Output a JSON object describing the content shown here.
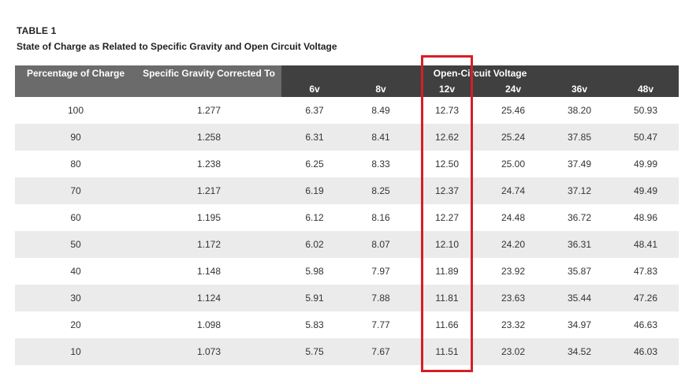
{
  "title": "TABLE 1",
  "caption": "State of Charge as Related to Specific Gravity and Open Circuit Voltage",
  "headers": {
    "percentage": "Percentage of Charge",
    "gravity": "Specific Gravity Corrected To",
    "voltage_group": "Open-Circuit Voltage",
    "voltages": [
      "6v",
      "8v",
      "12v",
      "24v",
      "36v",
      "48v"
    ]
  },
  "rows": [
    [
      "100",
      "1.277",
      "6.37",
      "8.49",
      "12.73",
      "25.46",
      "38.20",
      "50.93"
    ],
    [
      "90",
      "1.258",
      "6.31",
      "8.41",
      "12.62",
      "25.24",
      "37.85",
      "50.47"
    ],
    [
      "80",
      "1.238",
      "6.25",
      "8.33",
      "12.50",
      "25.00",
      "37.49",
      "49.99"
    ],
    [
      "70",
      "1.217",
      "6.19",
      "8.25",
      "12.37",
      "24.74",
      "37.12",
      "49.49"
    ],
    [
      "60",
      "1.195",
      "6.12",
      "8.16",
      "12.27",
      "24.48",
      "36.72",
      "48.96"
    ],
    [
      "50",
      "1.172",
      "6.02",
      "8.07",
      "12.10",
      "24.20",
      "36.31",
      "48.41"
    ],
    [
      "40",
      "1.148",
      "5.98",
      "7.97",
      "11.89",
      "23.92",
      "35.87",
      "47.83"
    ],
    [
      "30",
      "1.124",
      "5.91",
      "7.88",
      "11.81",
      "23.63",
      "35.44",
      "47.26"
    ],
    [
      "20",
      "1.098",
      "5.83",
      "7.77",
      "11.66",
      "23.32",
      "34.97",
      "46.63"
    ],
    [
      "10",
      "1.073",
      "5.75",
      "7.67",
      "11.51",
      "23.02",
      "34.52",
      "46.03"
    ]
  ],
  "highlight_color": "#d61f26",
  "header_colors": {
    "dark": "#404040",
    "mid": "#6b6b6b"
  },
  "row_shade": "#ebebeb"
}
